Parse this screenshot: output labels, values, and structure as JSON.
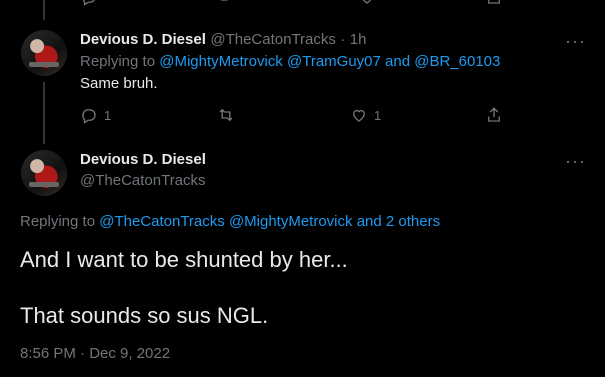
{
  "tweet1": {
    "author_name": "Devious D. Diesel",
    "author_handle": "@TheCatonTracks",
    "separator": "·",
    "time": "1h",
    "replying_prefix": "Replying to",
    "mention1": "@MightyMetrovick",
    "mention2": "@TramGuy07",
    "and_word": "and",
    "mention3": "@BR_60103",
    "text": "Same bruh.",
    "reply_count": "1",
    "like_count": "1"
  },
  "tweet2": {
    "author_name": "Devious D. Diesel",
    "author_handle": "@TheCatonTracks",
    "replying_prefix": "Replying to",
    "mention1": "@TheCatonTracks",
    "mention2": "@MightyMetrovick",
    "others": "and 2 others",
    "text_line1": "And I want to be shunted by her...",
    "text_line2": "That sounds so sus NGL.",
    "datetime": "8:56 PM · Dec 9, 2022"
  },
  "icons": {
    "more": "more-icon",
    "reply": "reply-icon",
    "retweet": "retweet-icon",
    "like": "like-icon",
    "share": "share-icon"
  },
  "colors": {
    "accent": "#1d9bf0",
    "muted": "#71767b",
    "text": "#e7e9ea",
    "background": "#000000"
  }
}
